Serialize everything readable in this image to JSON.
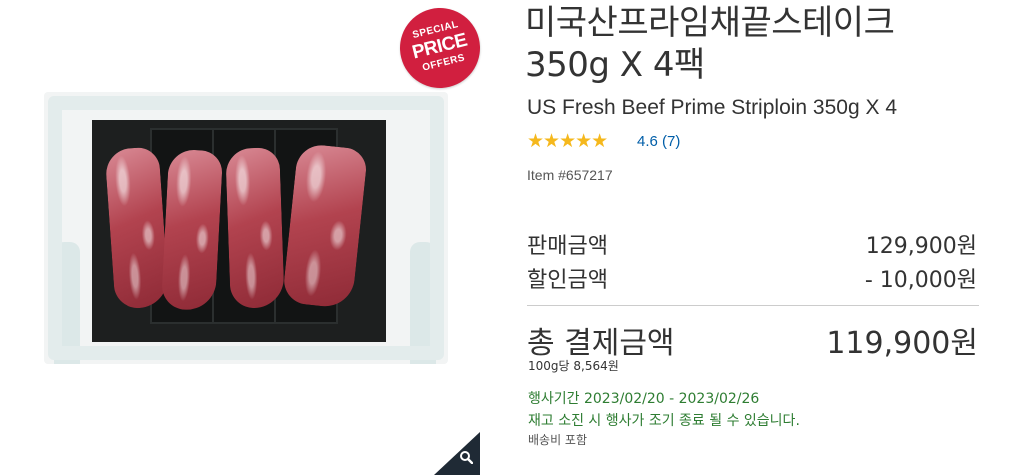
{
  "badge": {
    "line1": "SPECIAL",
    "line2": "PRICE",
    "line3": "OFFERS"
  },
  "product": {
    "title_ko": "미국산프라임채끝스테이크 350g X 4팩",
    "title_en": "US Fresh Beef Prime Striploin 350g X 4",
    "stars": "★★★★★",
    "rating_value": "4.6",
    "review_count": "(7)",
    "item_number": "Item #657217"
  },
  "pricing": {
    "sale_label": "판매금액",
    "sale_value": "129,900원",
    "discount_label": "할인금액",
    "discount_value": "- 10,000원",
    "total_label": "총 결제금액",
    "total_value": "119,900원",
    "unit_price": "100g당 8,564원"
  },
  "promo": {
    "period": "행사기간 2023/02/20 - 2023/02/26",
    "notice": "재고 소진 시 행사가 조기 종료 될 수 있습니다."
  },
  "shipping": "배송비 포함",
  "icons": {
    "zoom": "magnifier-icon"
  },
  "colors": {
    "badge": "#d11f3f",
    "stars": "#f5b81d",
    "link": "#005ea8",
    "promo": "#2e7d32"
  }
}
